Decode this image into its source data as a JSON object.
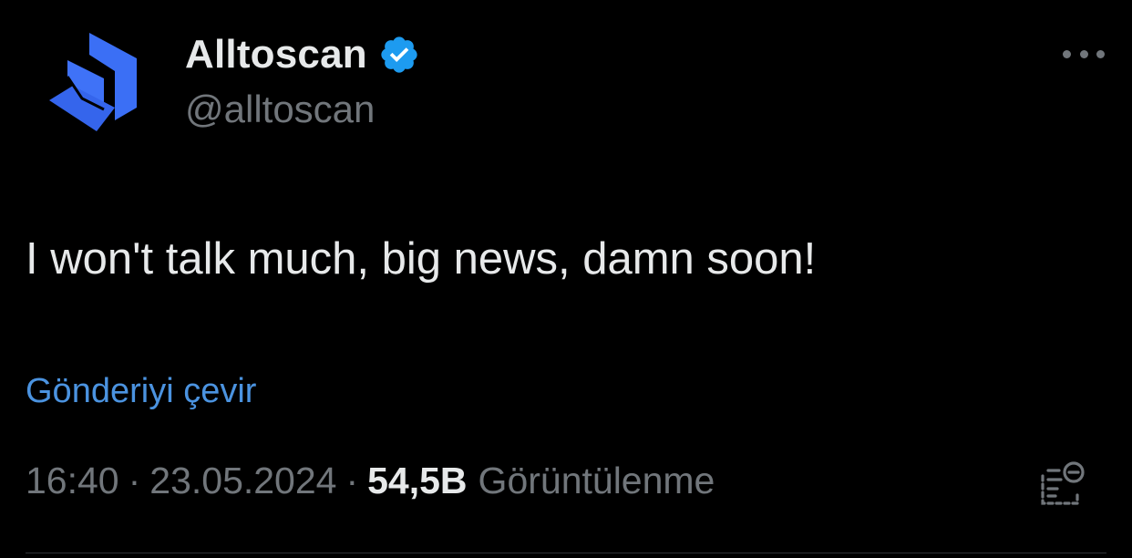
{
  "author": {
    "display_name": "Alltoscan",
    "handle": "@alltoscan",
    "verified": true,
    "avatar_icon": "alltoscan-logo-icon"
  },
  "post": {
    "text": "I won't talk much, big news, damn soon!",
    "translate_label": "Gönderiyi çevir"
  },
  "meta": {
    "time": "16:40",
    "separator": "·",
    "date": "23.05.2024",
    "views_count": "54,5B",
    "views_label": "Görüntülenme"
  },
  "icons": {
    "more": "more-options-icon",
    "analytics": "post-analytics-icon",
    "verified": "verified-badge-icon"
  },
  "colors": {
    "background": "#000000",
    "primary_text": "#e7e9ea",
    "secondary_text": "#71767b",
    "link": "#4b93e0",
    "verified": "#1d9bf0",
    "logo": "#3b6ff5"
  }
}
